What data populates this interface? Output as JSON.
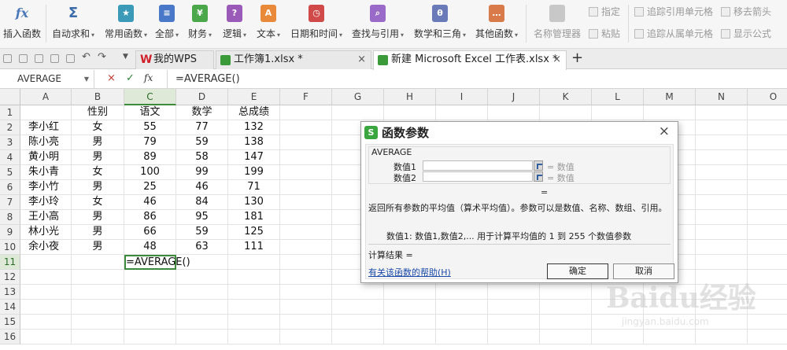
{
  "ribbon": {
    "buttons": [
      {
        "label": "插入函数",
        "dropdown": false,
        "color": "#4a78b8"
      },
      {
        "label": "自动求和",
        "dropdown": true,
        "color": "#3a6aaa"
      },
      {
        "label": "常用函数",
        "dropdown": true,
        "color": "#3a9ab8"
      },
      {
        "label": "全部",
        "dropdown": true,
        "color": "#4a78c8"
      },
      {
        "label": "财务",
        "dropdown": true,
        "color": "#4aa84a"
      },
      {
        "label": "逻辑",
        "dropdown": true,
        "color": "#9a5ab8"
      },
      {
        "label": "文本",
        "dropdown": true,
        "color": "#e88a3a"
      },
      {
        "label": "日期和时间",
        "dropdown": true,
        "color": "#d04a4a"
      },
      {
        "label": "查找与引用",
        "dropdown": true,
        "color": "#9a6ac8"
      },
      {
        "label": "数学和三角",
        "dropdown": true,
        "color": "#6a7ab8"
      },
      {
        "label": "其他函数",
        "dropdown": true,
        "color": "#d87a4a"
      }
    ],
    "name_manager": "名称管理器",
    "specify": "指定",
    "paste": "粘贴",
    "trace_precedents": "追踪引用单元格",
    "trace_dependents": "追踪从属单元格",
    "remove_arrows": "移去箭头",
    "show_formulas": "显示公式"
  },
  "tabs": [
    {
      "label": "我的WPS",
      "icon": "wps-logo-icon"
    },
    {
      "label": "工作簿1.xlsx *",
      "icon": "excel-file-icon"
    },
    {
      "label": "新建 Microsoft Excel 工作表.xlsx *",
      "icon": "excel-file-icon"
    }
  ],
  "formula_bar": {
    "name_box": "AVERAGE",
    "cancel": "×",
    "confirm": "✓",
    "fx": "fx",
    "content": "=AVERAGE()"
  },
  "sheet": {
    "columns": [
      "A",
      "B",
      "C",
      "D",
      "E",
      "F",
      "G",
      "H",
      "I",
      "J",
      "K",
      "L",
      "M",
      "N",
      "O"
    ],
    "selected_column": "C",
    "selected_row": "11",
    "rows": [
      [
        "",
        "性别",
        "语文",
        "数学",
        "总成绩"
      ],
      [
        "李小红",
        "女",
        "55",
        "77",
        "132"
      ],
      [
        "陈小亮",
        "男",
        "79",
        "59",
        "138"
      ],
      [
        "黄小明",
        "男",
        "89",
        "58",
        "147"
      ],
      [
        "朱小青",
        "女",
        "100",
        "99",
        "199"
      ],
      [
        "李小竹",
        "男",
        "25",
        "46",
        "71"
      ],
      [
        "李小玲",
        "女",
        "46",
        "84",
        "130"
      ],
      [
        "王小高",
        "男",
        "86",
        "95",
        "181"
      ],
      [
        "林小光",
        "男",
        "66",
        "59",
        "125"
      ],
      [
        "余小夜",
        "男",
        "48",
        "63",
        "111"
      ],
      [
        "",
        "",
        "=AVERAGE()",
        "",
        ""
      ]
    ],
    "row_numbers": [
      "1",
      "2",
      "3",
      "4",
      "5",
      "6",
      "7",
      "8",
      "9",
      "10",
      "11",
      "12",
      "13",
      "14",
      "15",
      "16"
    ]
  },
  "dialog": {
    "title": "函数参数",
    "logo": "S",
    "close": "×",
    "function_name": "AVERAGE",
    "args": [
      {
        "label": "数值1",
        "value": "= 数值"
      },
      {
        "label": "数值2",
        "value": "= 数值"
      }
    ],
    "equals": "=",
    "description": "返回所有参数的平均值（算术平均值）。参数可以是数值、名称、数组、引用。",
    "arg_description": "数值1: 数值1,数值2,... 用于计算平均值的 1 到 255 个数值参数",
    "result": "计算结果 =",
    "help_link": "有关该函数的帮助(H)",
    "ok": "确定",
    "cancel": "取消"
  },
  "watermark": {
    "main": "Baidu经验",
    "sub": "jingyan.baidu.com"
  }
}
